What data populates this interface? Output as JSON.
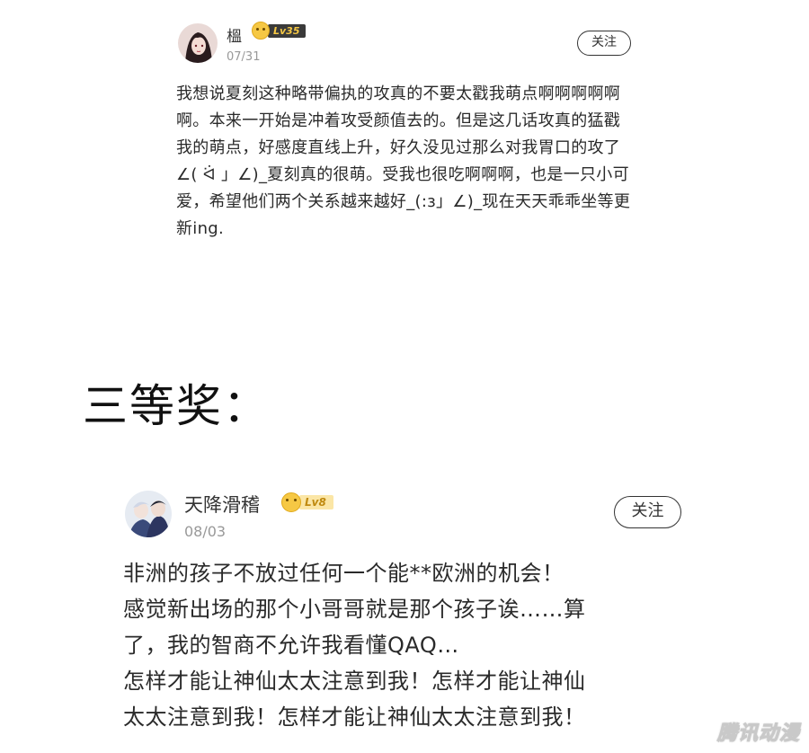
{
  "comments": [
    {
      "username": "榲",
      "level": "Lv35",
      "date": "07/31",
      "follow_label": "关注",
      "text": "我想说夏刻这种略带偏执的攻真的不要太戳我萌点啊啊啊啊啊啊。本来一开始是冲着攻受颜值去的。但是这几话攻真的猛戳我的萌点，好感度直线上升，好久没见过那么对我胃口的攻了∠( ᐛ 」∠)_夏刻真的很萌。受我也很吃啊啊啊，也是一只小可爱，希望他们两个关系越来越好_(:з」∠)_现在天天乖乖坐等更新ing."
    },
    {
      "username": "天降滑稽",
      "level": "Lv8",
      "date": "08/03",
      "follow_label": "关注",
      "lines": [
        "非洲的孩子不放过任何一个能**欧洲的机会！",
        "感觉新出场的那个小哥哥就是那个孩子诶……算",
        "了，我的智商不允许我看懂QAQ…",
        "怎样才能让神仙太太注意到我！怎样才能让神仙",
        "太太注意到我！怎样才能让神仙太太注意到我！"
      ]
    }
  ],
  "section_heading": "三等奖：",
  "watermark": "腾讯动漫",
  "icons": {
    "level_badge": "smiley-face-icon"
  },
  "colors": {
    "text": "#2a2a2a",
    "muted": "#999999",
    "badge_gold": "#f6c844"
  }
}
